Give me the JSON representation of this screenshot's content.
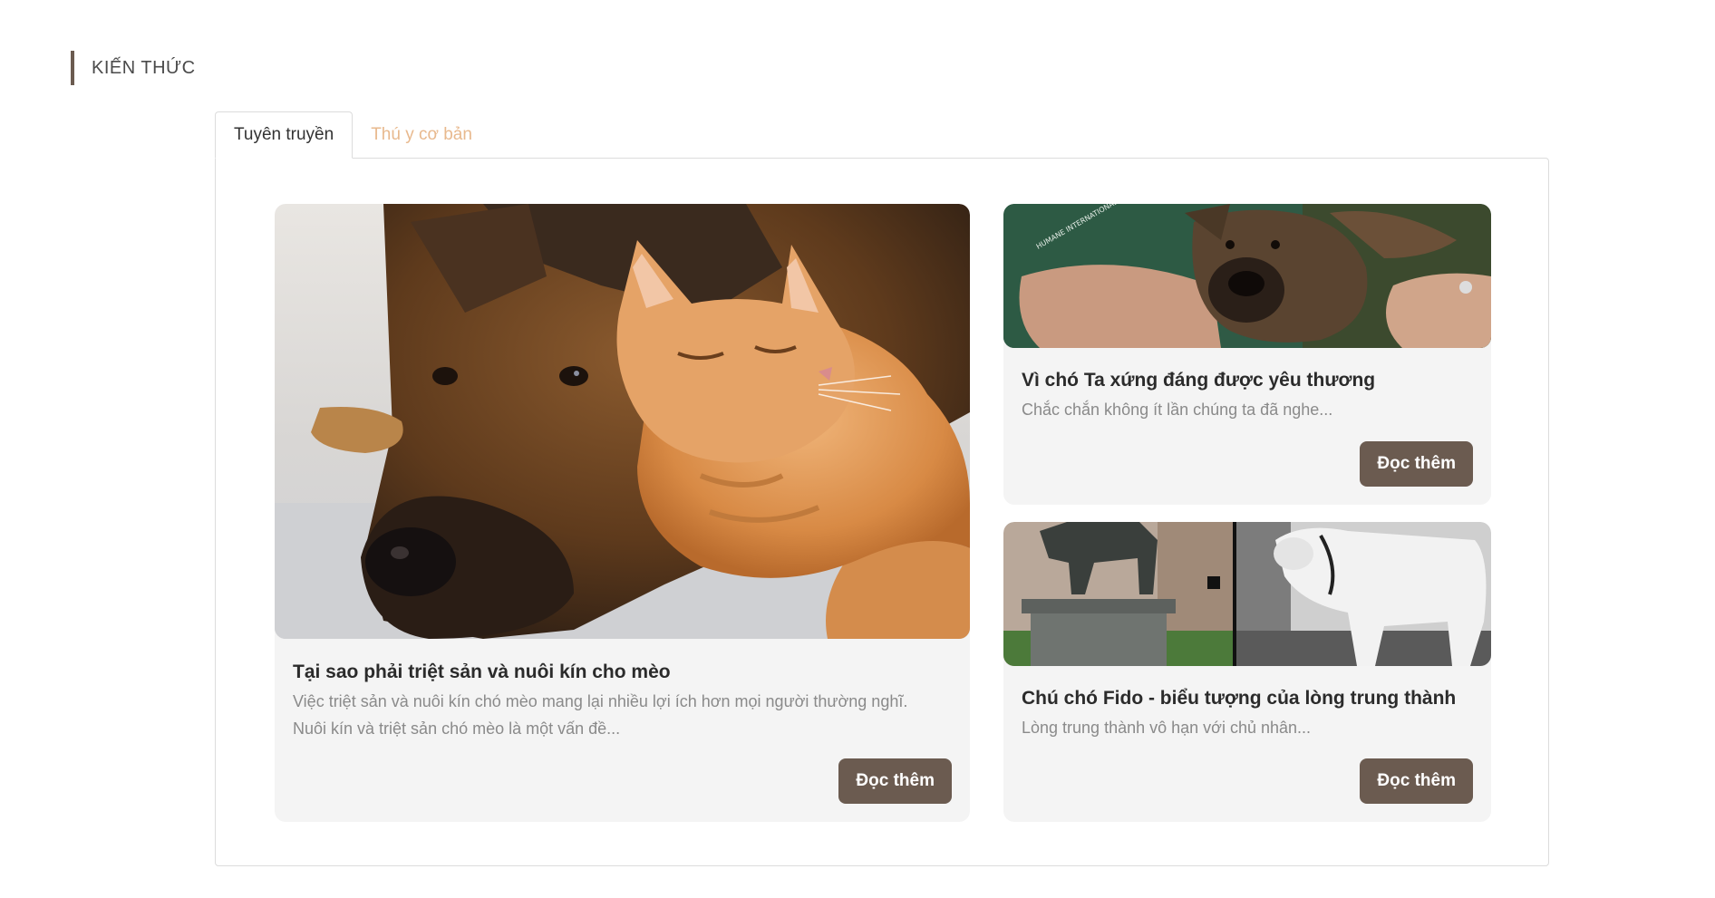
{
  "section": {
    "heading": "KIẾN THỨC"
  },
  "tabs": [
    {
      "label": "Tuyên truyền",
      "active": true
    },
    {
      "label": "Thú y cơ bản",
      "active": false
    }
  ],
  "articles": [
    {
      "title": "Tại sao phải triệt sản và nuôi kín cho mèo",
      "excerpt": "Việc triệt sản và nuôi kín chó mèo mang lại nhiều lợi ích hơn mọi người thường nghĩ. Nuôi kín và triệt sản chó mèo là một vấn đề...",
      "button": "Đọc thêm",
      "image": "dog-and-cat-photo"
    },
    {
      "title": "Vì chó Ta xứng đáng được yêu thương",
      "excerpt": "Chắc chắn không ít lần chúng ta đã nghe...",
      "button": "Đọc thêm",
      "image": "puppy-hug-photo",
      "image_text": "HUMANE INTERNATIONAL"
    },
    {
      "title": "Chú chó Fido - biểu tượng của lòng trung thành",
      "excerpt": "Lòng trung thành vô hạn với chủ nhân...",
      "button": "Đọc thêm",
      "image": "fido-statue-photo"
    }
  ],
  "colors": {
    "accent": "#6b5b50",
    "inactive_tab": "#e8b98e",
    "card_bg": "#f4f4f4"
  }
}
